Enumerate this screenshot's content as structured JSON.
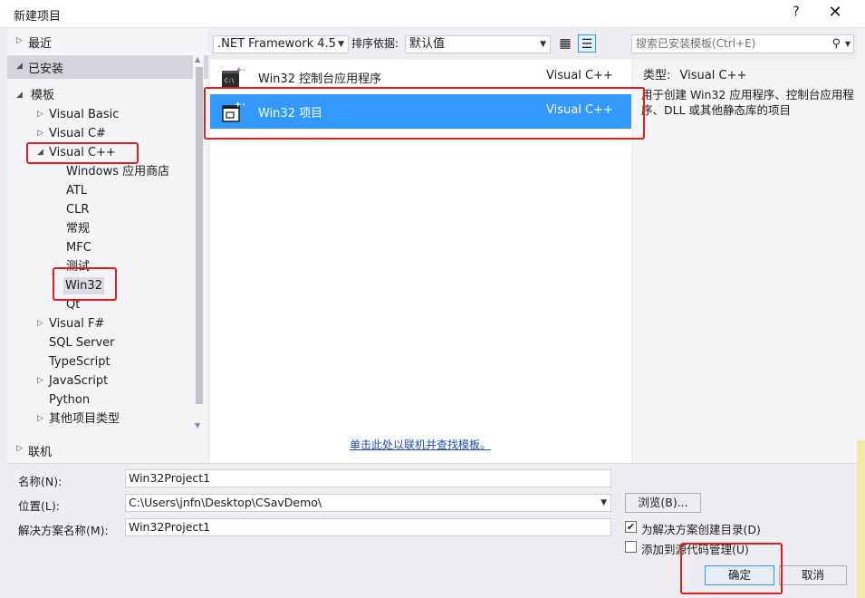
{
  "window": {
    "title": "新建项目",
    "help": "?",
    "close": "✕"
  },
  "left": {
    "recent": "最近",
    "installed": "已安装",
    "online": "联机",
    "tree": {
      "templates": "模板",
      "vb": "Visual Basic",
      "cs": "Visual C#",
      "cpp": "Visual C++",
      "cpp_children": [
        "Windows 应用商店",
        "ATL",
        "CLR",
        "常规",
        "MFC",
        "测试",
        "Win32",
        "Qt"
      ],
      "fs": "Visual F#",
      "sql": "SQL Server",
      "ts": "TypeScript",
      "js": "JavaScript",
      "py": "Python",
      "other": "其他项目类型"
    }
  },
  "toolbar": {
    "framework": ".NET Framework 4.5",
    "sort_label": "排序依据:",
    "sort_value": "默认值",
    "search_placeholder": "搜索已安装模板(Ctrl+E)"
  },
  "templates": [
    {
      "name": "Win32 控制台应用程序",
      "lang": "Visual C++",
      "selected": false
    },
    {
      "name": "Win32 项目",
      "lang": "Visual C++",
      "selected": true
    }
  ],
  "online_link": "单击此处以联机并查找模板。",
  "details": {
    "type_label": "类型:",
    "type_value": "Visual C++",
    "description": "用于创建 Win32 应用程序、控制台应用程序、DLL 或其他静态库的项目"
  },
  "form": {
    "name_label": "名称(N):",
    "name_value": "Win32Project1",
    "location_label": "位置(L):",
    "location_value": "C:\\Users\\jnfn\\Desktop\\CSavDemo\\",
    "solution_label": "解决方案名称(M):",
    "solution_value": "Win32Project1",
    "browse": "浏览(B)...",
    "create_dir": "为解决方案创建目录(D)",
    "create_dir_checked": true,
    "add_source_control": "添加到源代码管理(U)",
    "add_source_control_checked": false,
    "ok": "确定",
    "cancel": "取消"
  },
  "colors": {
    "accent": "#3399ff",
    "highlight": "#e01e1e"
  }
}
